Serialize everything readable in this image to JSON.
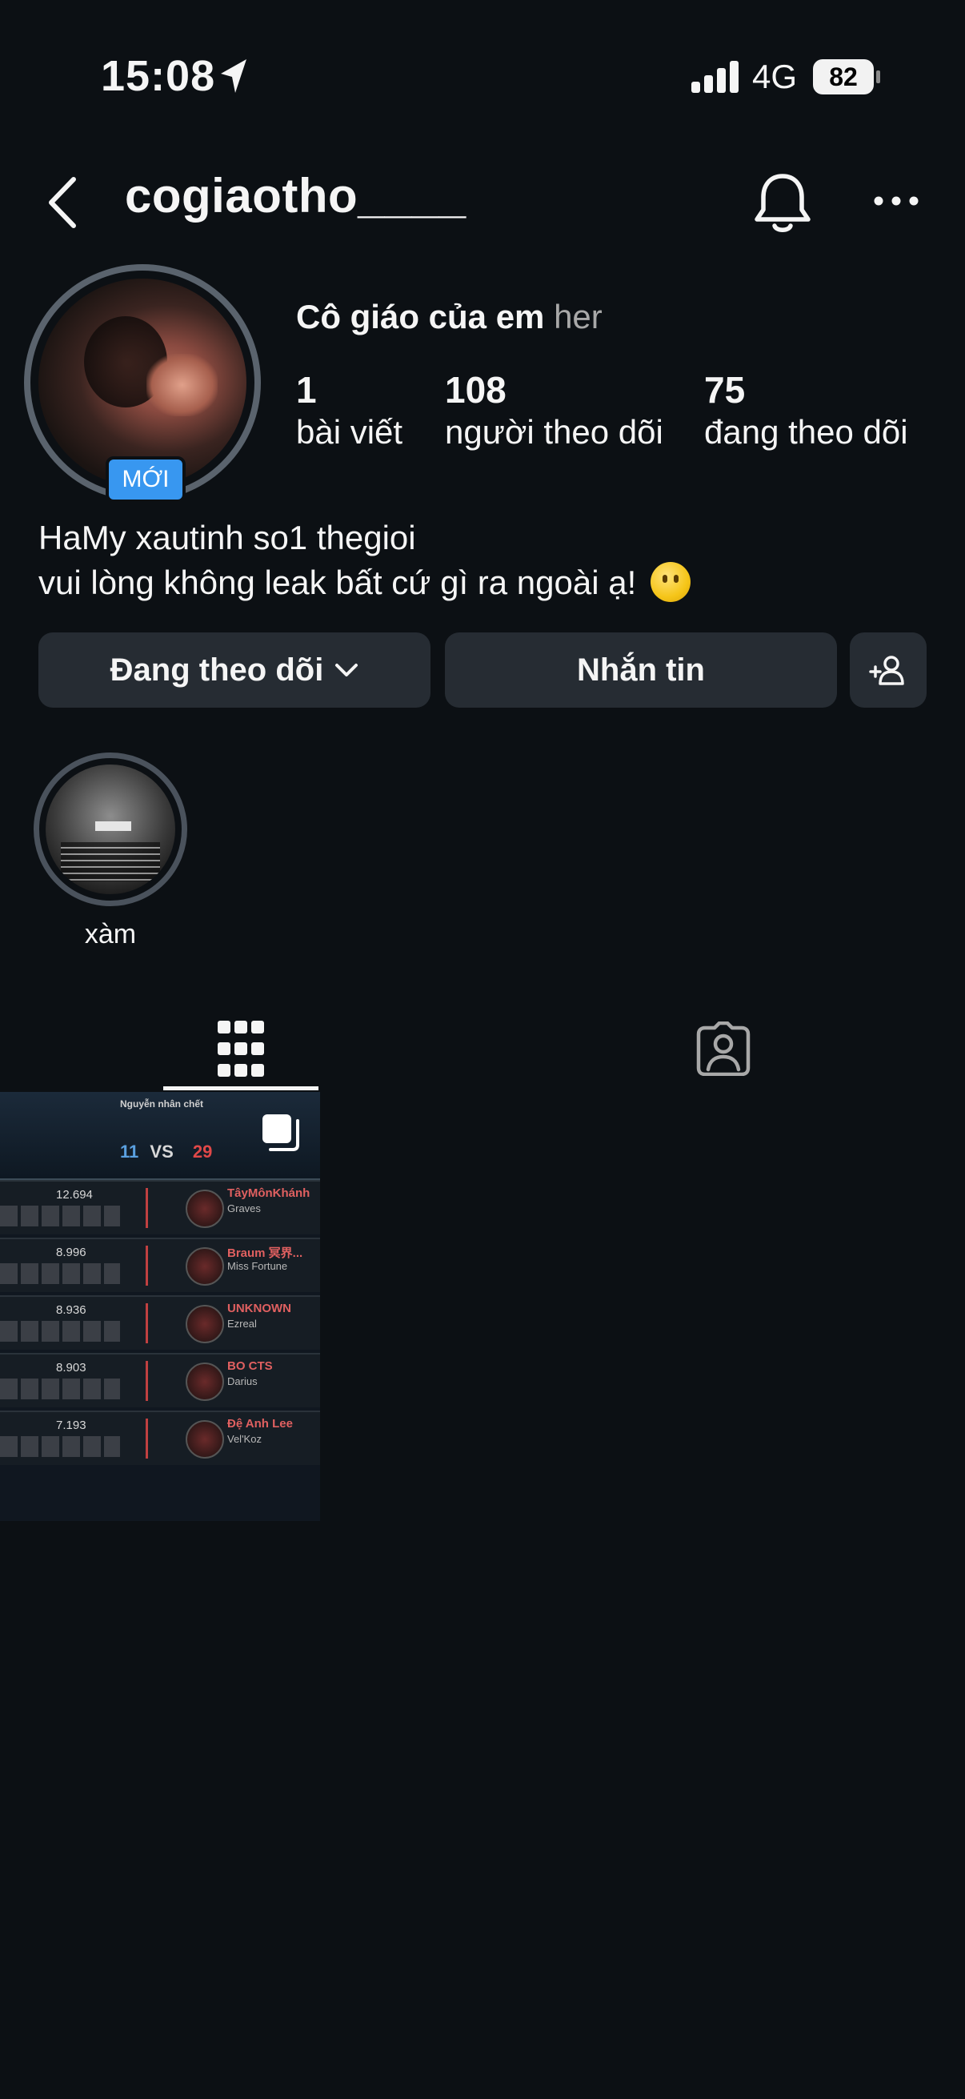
{
  "status_bar": {
    "time": "15:08",
    "network": "4G",
    "battery": "82"
  },
  "header": {
    "username": "cogiaotho____"
  },
  "profile": {
    "badge": "MỚI",
    "display_name": "Cô giáo của em",
    "pronoun": "her",
    "stats": {
      "posts": {
        "value": "1",
        "label": "bài viết"
      },
      "followers": {
        "value": "108",
        "label": "người theo dõi"
      },
      "following": {
        "value": "75",
        "label": "đang theo dõi"
      }
    },
    "bio": [
      "HaMy xautinh so1 thegioi",
      "vui lòng không leak bất cứ gì ra ngoài ạ!"
    ]
  },
  "actions": {
    "following_label": "Đang theo dõi",
    "message_label": "Nhắn tin"
  },
  "highlights": [
    {
      "label": "xàm"
    }
  ],
  "tabs": [
    "grid-icon",
    "tagged-icon"
  ],
  "post_thumbnail": {
    "cause": "Nguyễn nhân chết",
    "score_blue": "11",
    "score_vs": "VS",
    "score_red": "29",
    "rows": [
      {
        "gold": "12.694",
        "name": "TâyMônKhánh",
        "champ": "Graves"
      },
      {
        "gold": "8.996",
        "name": "Braum 冥界...",
        "champ": "Miss Fortune"
      },
      {
        "gold": "8.936",
        "name": "UNKNOWN",
        "champ": "Ezreal"
      },
      {
        "gold": "8.903",
        "name": "BO CTS",
        "champ": "Darius"
      },
      {
        "gold": "7.193",
        "name": "Đệ Anh Lee",
        "champ": "Vel'Koz"
      }
    ]
  },
  "colors": {
    "background": "#0c1014",
    "button": "#262c33",
    "badge": "#3897f0"
  }
}
